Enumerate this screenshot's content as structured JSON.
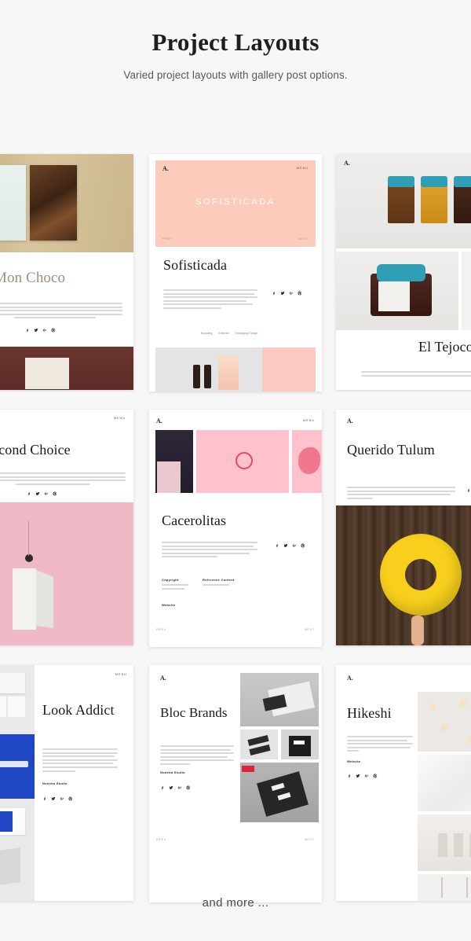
{
  "header": {
    "title": "Project Layouts",
    "subtitle": "Varied project layouts with gallery post options."
  },
  "footer": {
    "text": "and more  ..."
  },
  "colors": {
    "page_background": "#f7f7f7",
    "card_background": "#ffffff",
    "salmon_pink": "#fccbbc",
    "soft_pink": "#ffc2cd",
    "rose_pink": "#f2b8c0",
    "klein_blue": "#1f47c4",
    "yellow_float": "#f7cf1c",
    "teal_cloth": "#2e9fb5",
    "text_dark": "#1a1a1a",
    "text_muted": "#55595c"
  },
  "chrome": {
    "logo": "A.",
    "menu_label": "MENU",
    "prev_label": "PREV",
    "next_label": "NEXT"
  },
  "cards": [
    {
      "id": "mon-choco",
      "title": "Mon Choco",
      "layout": "image-top-text-middle-image-bottom",
      "has_social": true,
      "hero_kind": "chocolate-bar-gold",
      "footer_kind": "pattern-burgundy"
    },
    {
      "id": "sofisticada",
      "title": "Sofisticada",
      "hero_text": "SOFISTICADA",
      "layout": "pink-hero-text-gallery",
      "has_social": true,
      "tags": [
        "Branding",
        "Editorial",
        "Packaging Design"
      ],
      "hero_kind": "salmon-banner",
      "footer_kind": "dropper-bottles-and-pink"
    },
    {
      "id": "el-tejocote",
      "title": "El Tejocote",
      "layout": "image-image-text",
      "has_social": false,
      "hero_kind": "jam-jars-row",
      "mid_kind": "jam-jar-closeup"
    },
    {
      "id": "second-choice",
      "title": "Second Choice",
      "layout": "text-top-image-bottom",
      "has_social": true,
      "footer_kind": "pink-swatch-tag"
    },
    {
      "id": "cacerolitas",
      "title": "Cacerolitas",
      "layout": "gallery-strip-text-meta",
      "has_social": true,
      "meta": [
        {
          "label": "Copyright",
          "value": ""
        },
        {
          "label": "Reference Content",
          "value": ""
        }
      ],
      "website_label": "Website",
      "gallery_kinds": [
        "dark-navy-card",
        "pink-seal",
        "pink-brush"
      ]
    },
    {
      "id": "querido-tulum",
      "title": "Querido Tulum",
      "layout": "text-top-image-bottom",
      "has_social": true,
      "footer_kind": "yellow-float-on-wood"
    },
    {
      "id": "look-addict",
      "title": "Look Addict",
      "layout": "image-left-text-right",
      "has_social": true,
      "credit": "Nooeka Studio",
      "hero_kind": "blue-stationery"
    },
    {
      "id": "bloc-brands",
      "title": "Bloc Brands",
      "layout": "text-left-gallery-right",
      "has_social": true,
      "credit": "Nooeka Studio",
      "gallery_kinds": [
        "grey-notebook",
        "grey-blocks",
        "black-bag",
        "black-notebook-hand"
      ]
    },
    {
      "id": "hikeshi",
      "title": "Hikeshi",
      "layout": "text-left-gallery-right",
      "has_social": true,
      "website_label": "Website",
      "gallery_kinds": [
        "floral-pattern",
        "white-fabric",
        "white-bag-print",
        "white-hangers"
      ]
    }
  ]
}
